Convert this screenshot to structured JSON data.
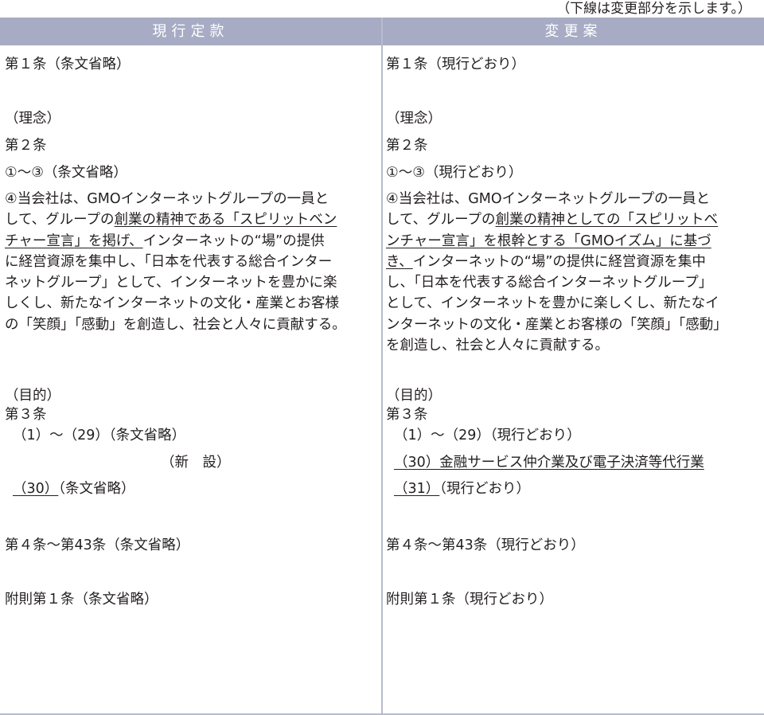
{
  "note": "（下線は変更部分を示します。）",
  "headers": {
    "current": "現行定款",
    "proposed": "変更案"
  },
  "current": {
    "art1": "第１条（条文省略）",
    "rinen": "（理念）",
    "art2": "第２条",
    "art2_items": "①～③（条文省略）",
    "art2_p4": {
      "l1": "④当会社は、GMOインターネットグループの一員と",
      "l2a": "して、グループの",
      "l2u": "創業の精神である「スピリットベン",
      "l3u": "チャー宣言」を掲げ、",
      "l3b": "インターネットの“場”の提供",
      "l4": "に経営資源を集中し、「日本を代表する総合インター",
      "l5": "ネットグループ」として、インターネットを豊かに楽",
      "l6": "しくし、新たなインターネットの文化・産業とお客様",
      "l7": "の「笑顔」「感動」を創造し、社会と人々に貢献する。"
    },
    "mokuteki": "（目的）",
    "art3": "第３条",
    "art3_items": "（1）～（29）（条文省略）",
    "shinsetsu": "（新　設）",
    "art3_30_num": "（30）",
    "art3_30_text": "（条文省略）",
    "art4_43": "第４条～第43条（条文省略）",
    "fusoku": "附則第１条（条文省略）"
  },
  "proposed": {
    "art1": "第１条（現行どおり）",
    "rinen": "（理念）",
    "art2": "第２条",
    "art2_items": "①～③（現行どおり）",
    "art2_p4": {
      "l1": "④当会社は、GMOインターネットグループの一員と",
      "l2a": "して、グループの",
      "l2u": "創業の精神としての「スピリットベ",
      "l3u": "ンチャー宣言」を根幹とする「GMOイズム」に基づ",
      "l4u": "き、",
      "l4b": "インターネットの“場”の提供に経営資源を集中",
      "l5": "し、「日本を代表する総合インターネットグループ」",
      "l6": "として、インターネットを豊かに楽しくし、新たなイ",
      "l7": "ンターネットの文化・産業とお客様の「笑顔」「感動」",
      "l8": "を創造し、社会と人々に貢献する。"
    },
    "mokuteki": "（目的）",
    "art3": "第３条",
    "art3_items": "（1）～（29）（現行どおり）",
    "art3_30": "（30）金融サービス仲介業及び電子決済等代行業",
    "art3_31_num": "（31）",
    "art3_31_text": "（現行どおり）",
    "art4_43": "第４条～第43条（現行どおり）",
    "fusoku": "附則第１条（現行どおり）"
  }
}
